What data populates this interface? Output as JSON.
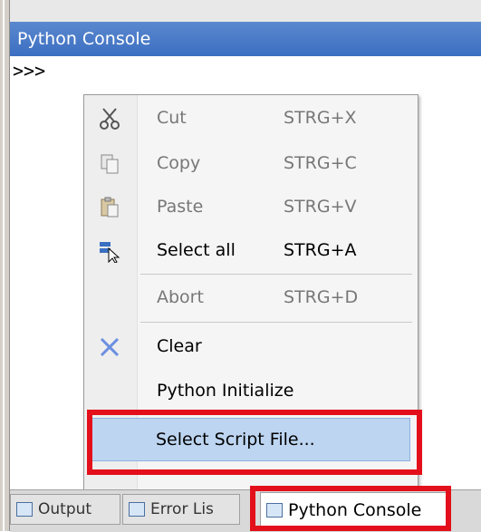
{
  "panel": {
    "title": "Python Console",
    "prompt": ">>>"
  },
  "context_menu": {
    "items": [
      {
        "label": "Cut",
        "shortcut": "STRG+X",
        "icon": "scissors-icon",
        "enabled": false
      },
      {
        "label": "Copy",
        "shortcut": "STRG+C",
        "icon": "copy-icon",
        "enabled": false
      },
      {
        "label": "Paste",
        "shortcut": "STRG+V",
        "icon": "paste-icon",
        "enabled": false
      },
      {
        "label": "Select all",
        "shortcut": "STRG+A",
        "icon": "select-all-icon",
        "enabled": true
      },
      {
        "label": "Abort",
        "shortcut": "STRG+D",
        "icon": "",
        "enabled": false
      },
      {
        "label": "Clear",
        "shortcut": "",
        "icon": "clear-x-icon",
        "enabled": true
      },
      {
        "label": "Python Initialize",
        "shortcut": "",
        "icon": "",
        "enabled": true
      },
      {
        "label": "Select Script File...",
        "shortcut": "",
        "icon": "",
        "enabled": true,
        "highlighted": true
      }
    ]
  },
  "tabs": [
    {
      "label": "Output",
      "icon": "output-icon",
      "active": false
    },
    {
      "label": "Error Lis",
      "icon": "error-list-icon",
      "active": false
    },
    {
      "label": "Python Console",
      "icon": "python-console-icon",
      "active": true
    }
  ],
  "colors": {
    "title_bar": "#3b6fc1",
    "highlight": "#bdd5f1",
    "annotation_red": "#e3101b"
  }
}
